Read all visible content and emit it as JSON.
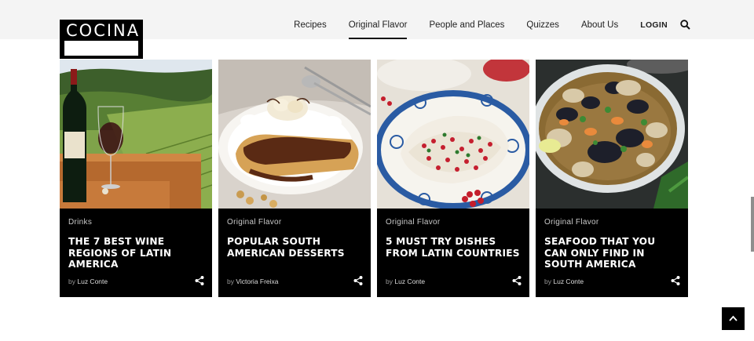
{
  "brand": {
    "logo_text": "COCINA"
  },
  "nav": {
    "items": [
      {
        "label": "Recipes",
        "active": false
      },
      {
        "label": "Original Flavor",
        "active": true
      },
      {
        "label": "People and Places",
        "active": false
      },
      {
        "label": "Quizzes",
        "active": false
      },
      {
        "label": "About Us",
        "active": false
      }
    ],
    "login_label": "LOGIN",
    "search_icon": "search-icon"
  },
  "cards": [
    {
      "category": "Drinks",
      "title": "THE 7 BEST WINE REGIONS OF LATIN AMERICA",
      "by": "by",
      "author": "Luz Conte",
      "image": "wine-vineyard"
    },
    {
      "category": "Original Flavor",
      "title": "POPULAR SOUTH AMERICAN DESSERTS",
      "by": "by",
      "author": "Victoria Freixa",
      "image": "crepes-dessert"
    },
    {
      "category": "Original Flavor",
      "title": "5 MUST TRY DISHES FROM LATIN COUNTRIES",
      "by": "by",
      "author": "Luz Conte",
      "image": "chiles-en-nogada"
    },
    {
      "category": "Original Flavor",
      "title": "SEAFOOD THAT YOU CAN ONLY FIND IN SOUTH AMERICA",
      "by": "by",
      "author": "Luz Conte",
      "image": "seafood-mussels"
    }
  ],
  "colors": {
    "card_bg": "#000000",
    "header_bg": "#f4f4f4",
    "text_dark": "#222222"
  }
}
